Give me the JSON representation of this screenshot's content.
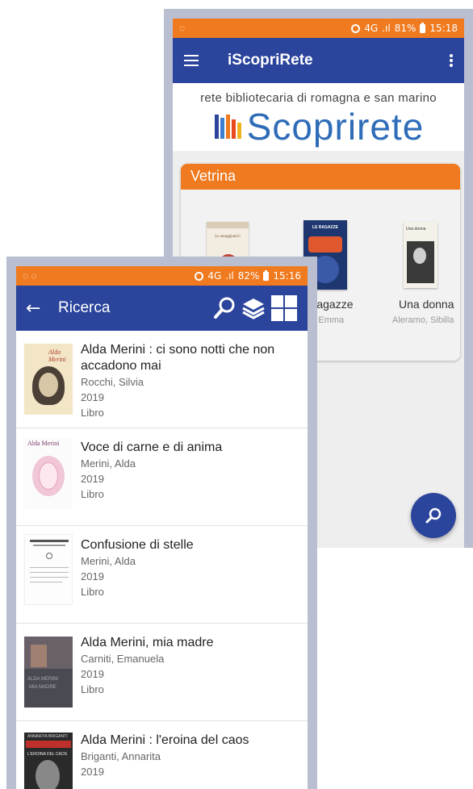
{
  "back_phone": {
    "status_bar": {
      "time": "15:18",
      "battery": "81%",
      "network": "4G"
    },
    "app_bar": {
      "title": "iScopriRete"
    },
    "hero": {
      "tagline": "rete bibliotecaria di romagna e san marino",
      "logo_text": "Scoprirete"
    },
    "vetrina": {
      "title": "Vetrina",
      "books": [
        {
          "title": "",
          "author": "",
          "cover_text": "Le assaggiatrici"
        },
        {
          "title": "e ragazze",
          "author": "ne, Emma",
          "cover_text": "LE RAGAZZE"
        },
        {
          "title": "Una donna",
          "author": "Aleramo, Sibilla",
          "cover_text": "Una donna"
        }
      ]
    }
  },
  "front_phone": {
    "status_bar": {
      "time": "15:16",
      "battery": "82%",
      "network": "4G"
    },
    "app_bar": {
      "title": "Ricerca"
    },
    "results": [
      {
        "title": "Alda Merini : ci sono notti che non accadono mai",
        "author": "Rocchi, Silvia",
        "year": "2019",
        "type": "Libro"
      },
      {
        "title": "Voce di carne e di anima",
        "author": "Merini, Alda",
        "year": "2019",
        "type": "Libro"
      },
      {
        "title": "Confusione di stelle",
        "author": "Merini, Alda",
        "year": "2019",
        "type": "Libro"
      },
      {
        "title": "Alda Merini, mia madre",
        "author": "Carniti, Emanuela",
        "year": "2019",
        "type": "Libro"
      },
      {
        "title": "Alda Merini : l'eroina del caos",
        "author": "Briganti, Annarita",
        "year": "2019",
        "type": ""
      }
    ]
  },
  "colors": {
    "primary": "#2b449c",
    "accent": "#f07a1f",
    "frame": "#b9bed0"
  },
  "icons": [
    "hamburger-icon",
    "kebab-menu-icon",
    "search-icon",
    "back-arrow-icon",
    "layers-icon",
    "grid-view-icon",
    "alarm-icon",
    "battery-icon"
  ]
}
